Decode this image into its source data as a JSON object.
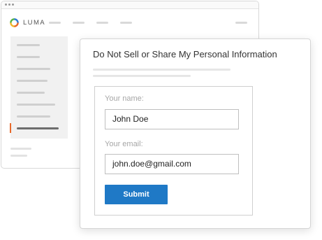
{
  "site": {
    "logo_text": "LUMA",
    "logo_icon": "luma-ring-logo-icon",
    "colors": {
      "accent_bar": "#e8692a",
      "button": "#1f79c6"
    }
  },
  "dialog": {
    "title": "Do Not Sell or Share My Personal Information",
    "form": {
      "name_label": "Your name:",
      "name_value": "John Doe",
      "email_label": "Your email:",
      "email_value": "john.doe@gmail.com",
      "submit_label": "Submit"
    }
  }
}
